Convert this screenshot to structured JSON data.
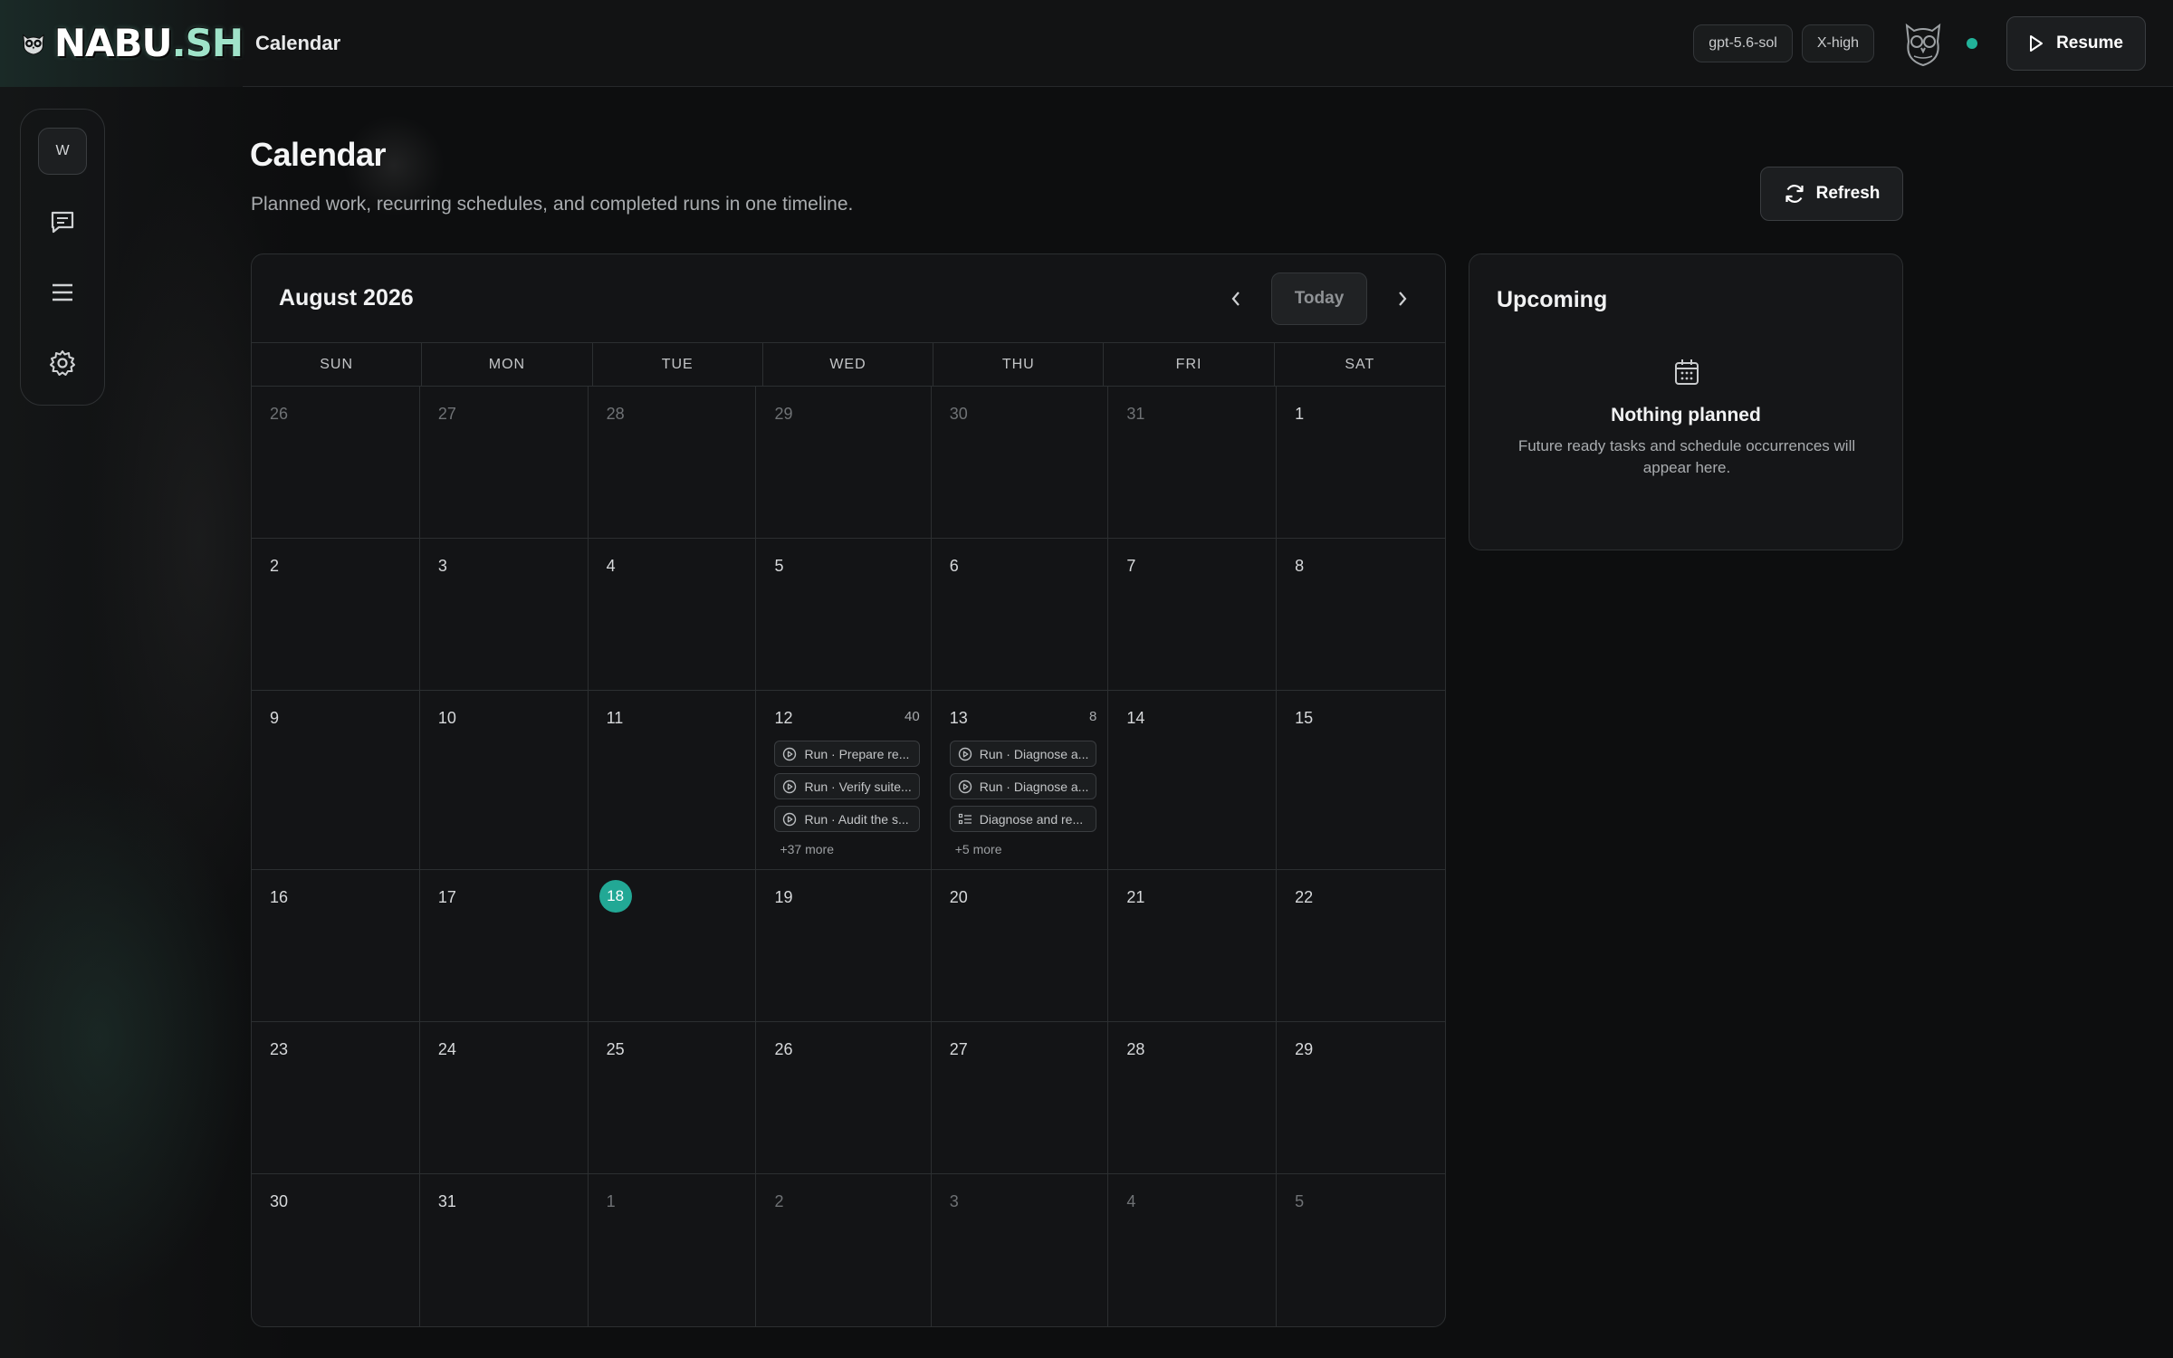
{
  "app": {
    "logo_text": "NABU",
    "logo_suffix": ".SH",
    "section": "Calendar"
  },
  "topbar": {
    "model": "gpt-5.6-sol",
    "effort": "X-high",
    "resume_label": "Resume",
    "status_color": "#22b39a"
  },
  "rail": {
    "workspace_initial": "W",
    "icons": [
      "chat-icon",
      "menu-icon",
      "gear-icon"
    ]
  },
  "page": {
    "title": "Calendar",
    "subtitle": "Planned work, recurring schedules, and completed runs in one timeline.",
    "refresh_label": "Refresh"
  },
  "calendar": {
    "month_label": "August 2026",
    "today_label": "Today",
    "weekdays": [
      "SUN",
      "MON",
      "TUE",
      "WED",
      "THU",
      "FRI",
      "SAT"
    ],
    "today": 18,
    "accent": "#22a895",
    "weeks": [
      [
        {
          "d": "26",
          "m": true
        },
        {
          "d": "27",
          "m": true
        },
        {
          "d": "28",
          "m": true
        },
        {
          "d": "29",
          "m": true
        },
        {
          "d": "30",
          "m": true
        },
        {
          "d": "31",
          "m": true
        },
        {
          "d": "1"
        }
      ],
      [
        {
          "d": "2"
        },
        {
          "d": "3"
        },
        {
          "d": "4"
        },
        {
          "d": "5"
        },
        {
          "d": "6"
        },
        {
          "d": "7"
        },
        {
          "d": "8"
        }
      ],
      [
        {
          "d": "9"
        },
        {
          "d": "10"
        },
        {
          "d": "11"
        },
        {
          "d": "12",
          "count": "40",
          "events": [
            {
              "icon": "run",
              "label": "Run · Prepare re..."
            },
            {
              "icon": "run",
              "label": "Run · Verify suite..."
            },
            {
              "icon": "run",
              "label": "Run · Audit the s..."
            }
          ],
          "more": "+37 more"
        },
        {
          "d": "13",
          "count": "8",
          "events": [
            {
              "icon": "run",
              "label": "Run · Diagnose a..."
            },
            {
              "icon": "run",
              "label": "Run · Diagnose a..."
            },
            {
              "icon": "task",
              "label": "Diagnose and re..."
            }
          ],
          "more": "+5 more"
        },
        {
          "d": "14"
        },
        {
          "d": "15"
        }
      ],
      [
        {
          "d": "16"
        },
        {
          "d": "17"
        },
        {
          "d": "18"
        },
        {
          "d": "19"
        },
        {
          "d": "20"
        },
        {
          "d": "21"
        },
        {
          "d": "22"
        }
      ],
      [
        {
          "d": "23"
        },
        {
          "d": "24"
        },
        {
          "d": "25"
        },
        {
          "d": "26"
        },
        {
          "d": "27"
        },
        {
          "d": "28"
        },
        {
          "d": "29"
        }
      ],
      [
        {
          "d": "30"
        },
        {
          "d": "31"
        },
        {
          "d": "1",
          "m": true
        },
        {
          "d": "2",
          "m": true
        },
        {
          "d": "3",
          "m": true
        },
        {
          "d": "4",
          "m": true
        },
        {
          "d": "5",
          "m": true
        }
      ]
    ]
  },
  "upcoming": {
    "title": "Upcoming",
    "empty_title": "Nothing planned",
    "empty_desc": "Future ready tasks and schedule occurrences will appear here."
  }
}
